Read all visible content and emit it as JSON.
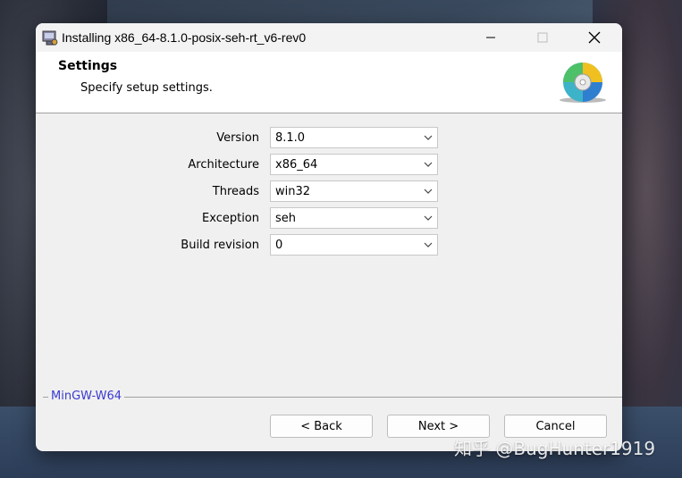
{
  "window": {
    "title": "Installing x86_64-8.1.0-posix-seh-rt_v6-rev0",
    "min_icon": "minimize-icon",
    "max_icon": "maximize-icon",
    "close_icon": "close-icon"
  },
  "header": {
    "title": "Settings",
    "subtitle": "Specify setup settings.",
    "icon": "cd-disc-icon"
  },
  "form": {
    "fields": [
      {
        "label": "Version",
        "value": "8.1.0"
      },
      {
        "label": "Architecture",
        "value": "x86_64"
      },
      {
        "label": "Threads",
        "value": "win32"
      },
      {
        "label": "Exception",
        "value": "seh"
      },
      {
        "label": "Build revision",
        "value": "0"
      }
    ]
  },
  "footer": {
    "brand": "MinGW-W64",
    "back_label": "< Back",
    "next_label": "Next >",
    "cancel_label": "Cancel"
  },
  "watermark": "知乎 @BugHunter1919",
  "colors": {
    "brand_text": "#3a3ad0",
    "header_bg": "#ffffff",
    "dialog_bg": "#f0f0f0"
  }
}
